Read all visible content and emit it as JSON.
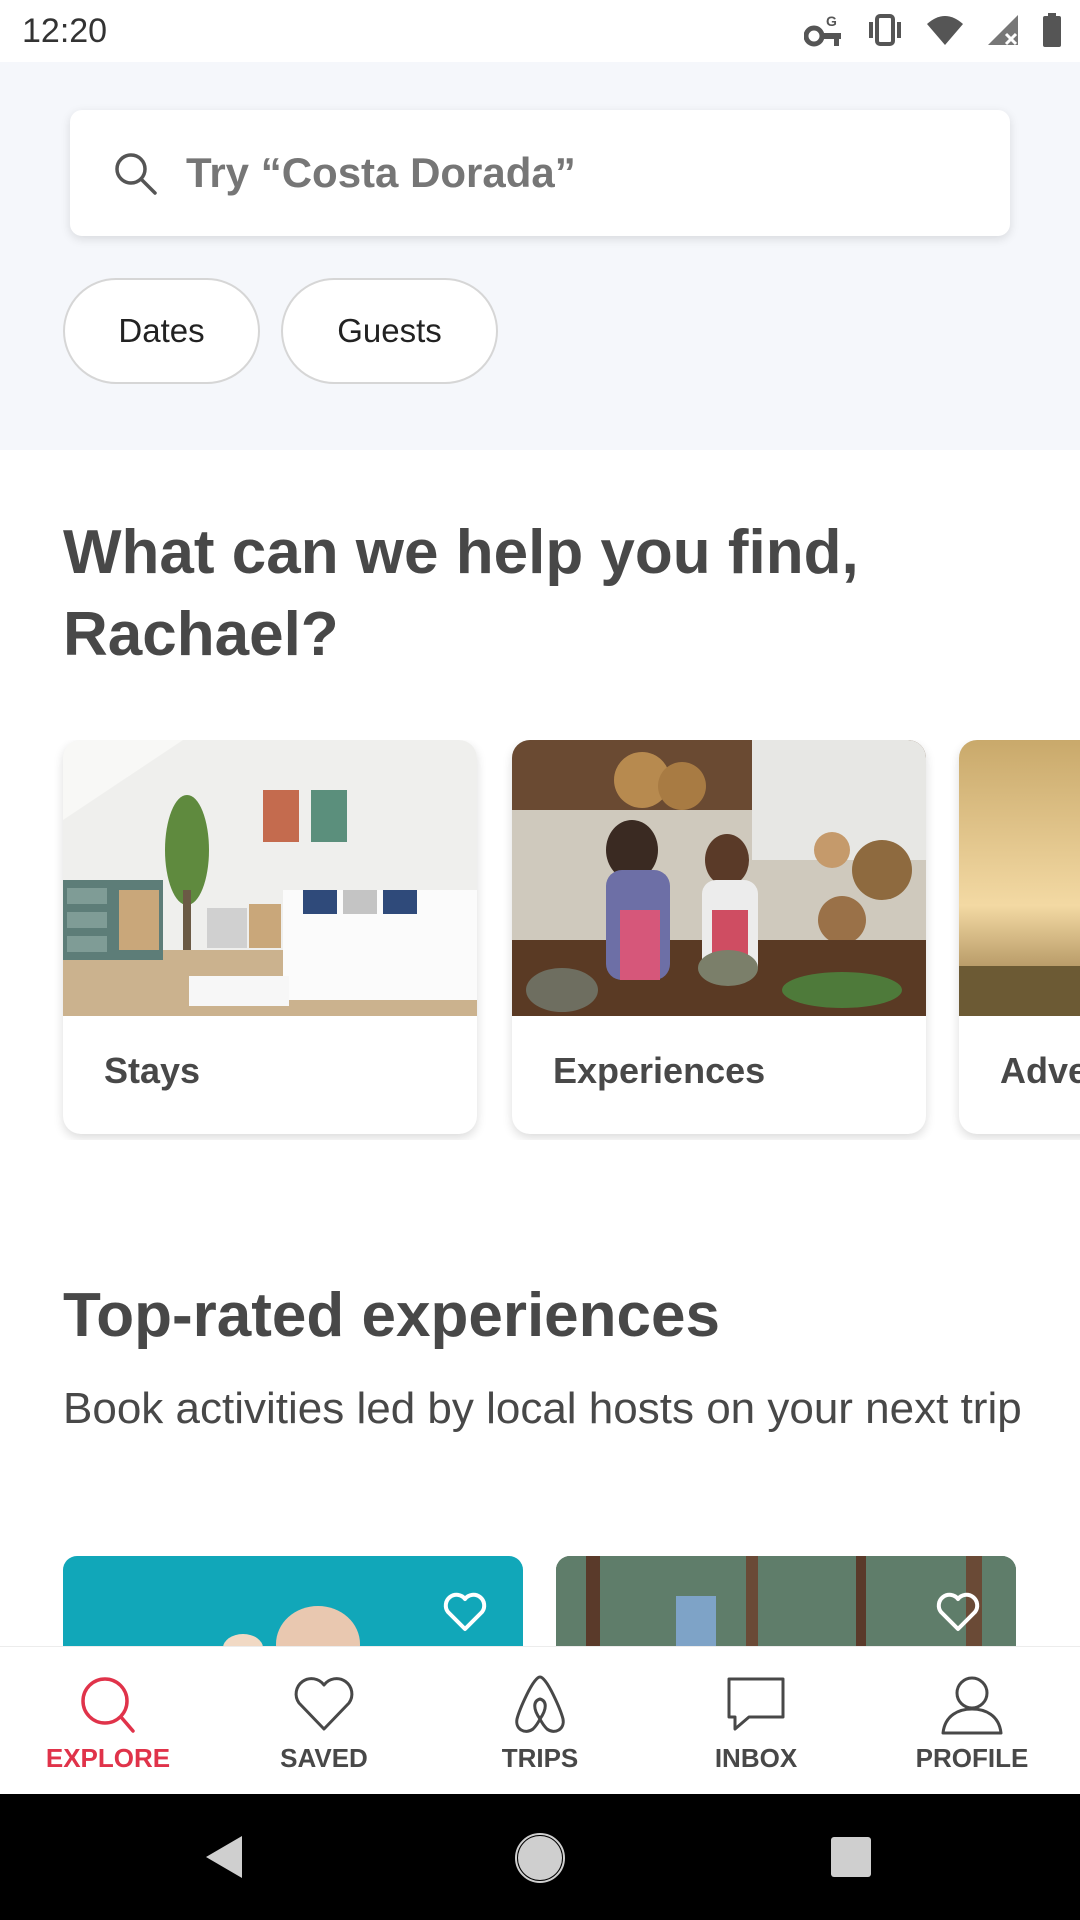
{
  "status_bar": {
    "time": "12:20",
    "icons": [
      "vpn-key-icon",
      "vibrate-icon",
      "wifi-icon",
      "signal-icon",
      "battery-icon"
    ]
  },
  "search": {
    "placeholder": "Try “Costa Dorada”",
    "filters": {
      "dates": "Dates",
      "guests": "Guests"
    }
  },
  "find_section": {
    "heading": "What can we help you find, Rachael?",
    "categories": [
      {
        "label": "Stays",
        "image": "bedroom-photo"
      },
      {
        "label": "Experiences",
        "image": "cooking-photo"
      },
      {
        "label": "Adve",
        "image": "sunset-photo"
      }
    ]
  },
  "top_rated": {
    "title": "Top-rated experiences",
    "subtitle": "Book activities led by local hosts on your next trip",
    "tiles": [
      {
        "image": "person-teal-photo",
        "icon": "heart-icon"
      },
      {
        "image": "forest-photo",
        "icon": "heart-icon"
      }
    ]
  },
  "bottom_nav": {
    "items": [
      {
        "label": "EXPLORE",
        "icon": "search-icon",
        "active": true
      },
      {
        "label": "SAVED",
        "icon": "heart-icon",
        "active": false
      },
      {
        "label": "TRIPS",
        "icon": "airbnb-logo-icon",
        "active": false
      },
      {
        "label": "INBOX",
        "icon": "message-icon",
        "active": false
      },
      {
        "label": "PROFILE",
        "icon": "person-icon",
        "active": false
      }
    ]
  },
  "colors": {
    "accent": "#e0334a",
    "text": "#484848",
    "search_bg": "#f5f7fb"
  }
}
